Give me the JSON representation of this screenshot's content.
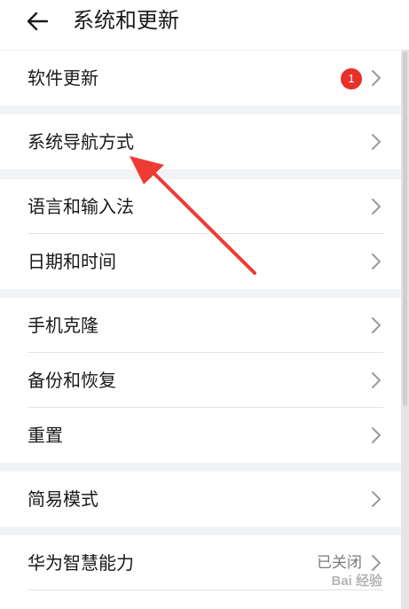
{
  "header": {
    "title": "系统和更新",
    "back_icon": "arrow-left-icon"
  },
  "groups": [
    {
      "rows": [
        {
          "label": "软件更新",
          "badge": "1"
        }
      ]
    },
    {
      "rows": [
        {
          "label": "系统导航方式"
        }
      ]
    },
    {
      "rows": [
        {
          "label": "语言和输入法"
        },
        {
          "label": "日期和时间"
        }
      ]
    },
    {
      "rows": [
        {
          "label": "手机克隆"
        },
        {
          "label": "备份和恢复"
        },
        {
          "label": "重置"
        }
      ]
    },
    {
      "rows": [
        {
          "label": "简易模式"
        }
      ]
    },
    {
      "rows": [
        {
          "label": "华为智慧能力",
          "value": "已关闭"
        }
      ]
    }
  ],
  "watermark": "Bai 经验",
  "colors": {
    "background": "#f1f3f5",
    "card": "#ffffff",
    "badge": "#e8302b",
    "annotation_arrow": "#ee3b33"
  }
}
